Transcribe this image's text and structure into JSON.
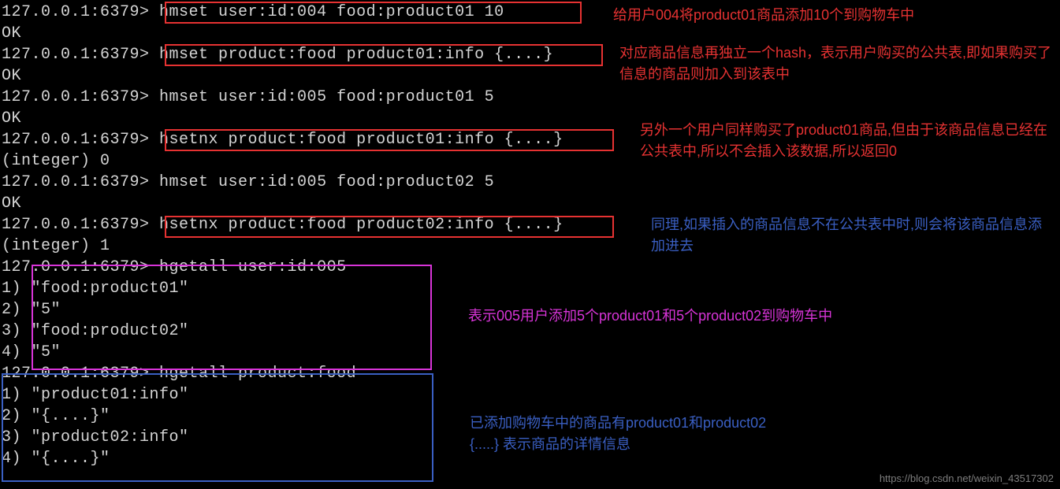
{
  "prompt": "127.0.0.1:6379>",
  "ok": "OK",
  "lines": {
    "l1": "127.0.0.1:6379> hmset user:id:004 food:product01 10",
    "l2": "OK",
    "l3": "127.0.0.1:6379> hmset product:food product01:info {....}",
    "l4": "OK",
    "l5": "127.0.0.1:6379> hmset user:id:005 food:product01 5",
    "l6": "OK",
    "l7": "127.0.0.1:6379> hsetnx product:food product01:info {....}",
    "l8": "(integer) 0",
    "l9": "127.0.0.1:6379> hmset user:id:005 food:product02 5",
    "l10": "OK",
    "l11": "127.0.0.1:6379> hsetnx product:food product02:info {....}",
    "l12": "(integer) 1",
    "l13": "127.0.0.1:6379> hgetall user:id:005",
    "l14": "1) \"food:product01\"",
    "l15": "2) \"5\"",
    "l16": "3) \"food:product02\"",
    "l17": "4) \"5\"",
    "l18": "127.0.0.1:6379> hgetall product:food",
    "l19": "1) \"product01:info\"",
    "l20": "2) \"{....}\"",
    "l21": "3) \"product02:info\"",
    "l22": "4) \"{....}\""
  },
  "annotations": {
    "a1": "给用户004将product01商品添加10个到购物车中",
    "a2": "对应商品信息再独立一个hash，表示用户购买的公共表,即如果购买了信息的商品则加入到该表中",
    "a3": "另外一个用户同样购买了product01商品,但由于该商品信息已经在公共表中,所以不会插入该数据,所以返回0",
    "a4": "同理,如果插入的商品信息不在公共表中时,则会将该商品信息添加进去",
    "a5": "表示005用户添加5个product01和5个product02到购物车中",
    "a6_l1": "已添加购物车中的商品有product01和product02",
    "a6_l2": "{.....} 表示商品的详情信息"
  },
  "watermark": "https://blog.csdn.net/weixin_43517302"
}
